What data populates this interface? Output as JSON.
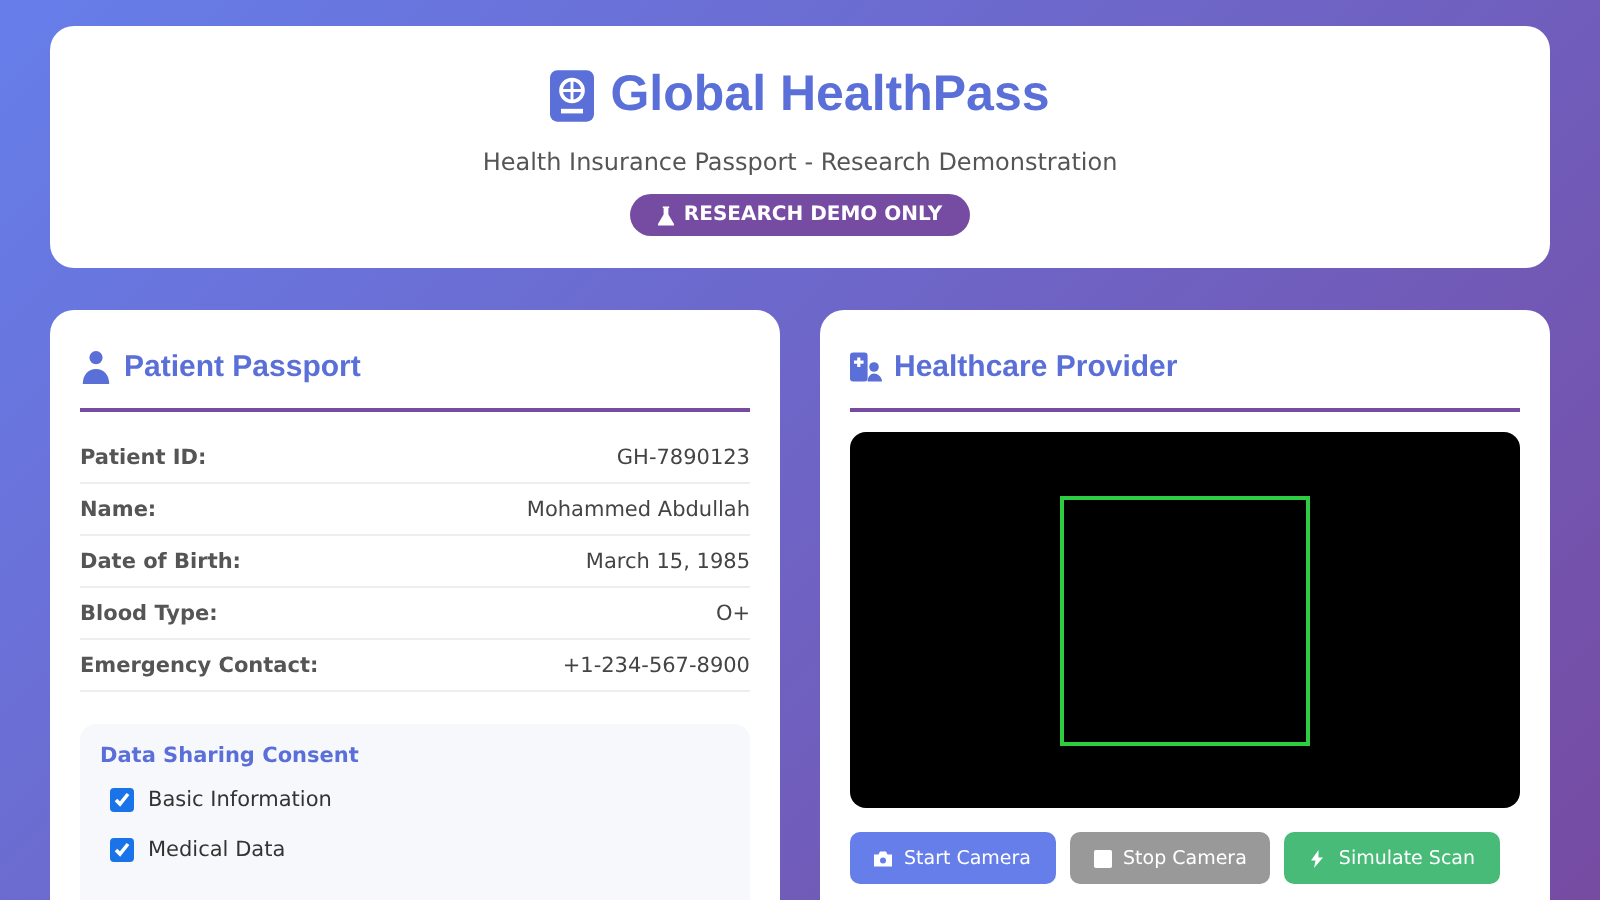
{
  "header": {
    "title": "Global HealthPass",
    "subtitle": "Health Insurance Passport - Research Demonstration",
    "badge": "RESEARCH DEMO ONLY"
  },
  "patient": {
    "title": "Patient Passport",
    "fields": [
      {
        "label": "Patient ID:",
        "value": "GH-7890123"
      },
      {
        "label": "Name:",
        "value": "Mohammed Abdullah"
      },
      {
        "label": "Date of Birth:",
        "value": "March 15, 1985"
      },
      {
        "label": "Blood Type:",
        "value": "O+"
      },
      {
        "label": "Emergency Contact:",
        "value": "+1-234-567-8900"
      }
    ],
    "consent": {
      "title": "Data Sharing Consent",
      "items": [
        {
          "label": "Basic Information",
          "checked": true
        },
        {
          "label": "Medical Data",
          "checked": true
        }
      ]
    }
  },
  "provider": {
    "title": "Healthcare Provider",
    "buttons": [
      {
        "label": "Start Camera",
        "kind": "primary",
        "disabled": false
      },
      {
        "label": "Stop Camera",
        "kind": "stop",
        "disabled": true
      },
      {
        "label": "Simulate Scan",
        "kind": "scan",
        "disabled": false
      }
    ]
  }
}
